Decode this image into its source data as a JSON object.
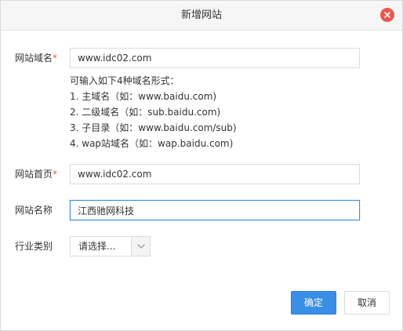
{
  "dialog": {
    "title": "新增网站",
    "close_icon": "close-icon"
  },
  "form": {
    "domain": {
      "label": "网站域名",
      "required_mark": "*",
      "value": "www.idc02.com",
      "hints": [
        "可输入如下4种域名形式：",
        "1. 主域名（如：www.baidu.com)",
        "2. 二级域名（如：sub.baidu.com)",
        "3. 子目录（如：www.baidu.com/sub)",
        "4. wap站域名（如：wap.baidu.com)"
      ]
    },
    "homepage": {
      "label": "网站首页",
      "required_mark": "*",
      "value": "www.idc02.com"
    },
    "site_name": {
      "label": "网站名称",
      "value": "江西驰网科技"
    },
    "industry": {
      "label": "行业类别",
      "selected": "请选择...",
      "arrow_icon": "chevron-down-icon"
    }
  },
  "buttons": {
    "ok_label": "确定",
    "cancel_label": "取消"
  },
  "colors": {
    "accent": "#3a8ee6",
    "close": "#e8594c",
    "required": "#e8594c"
  }
}
